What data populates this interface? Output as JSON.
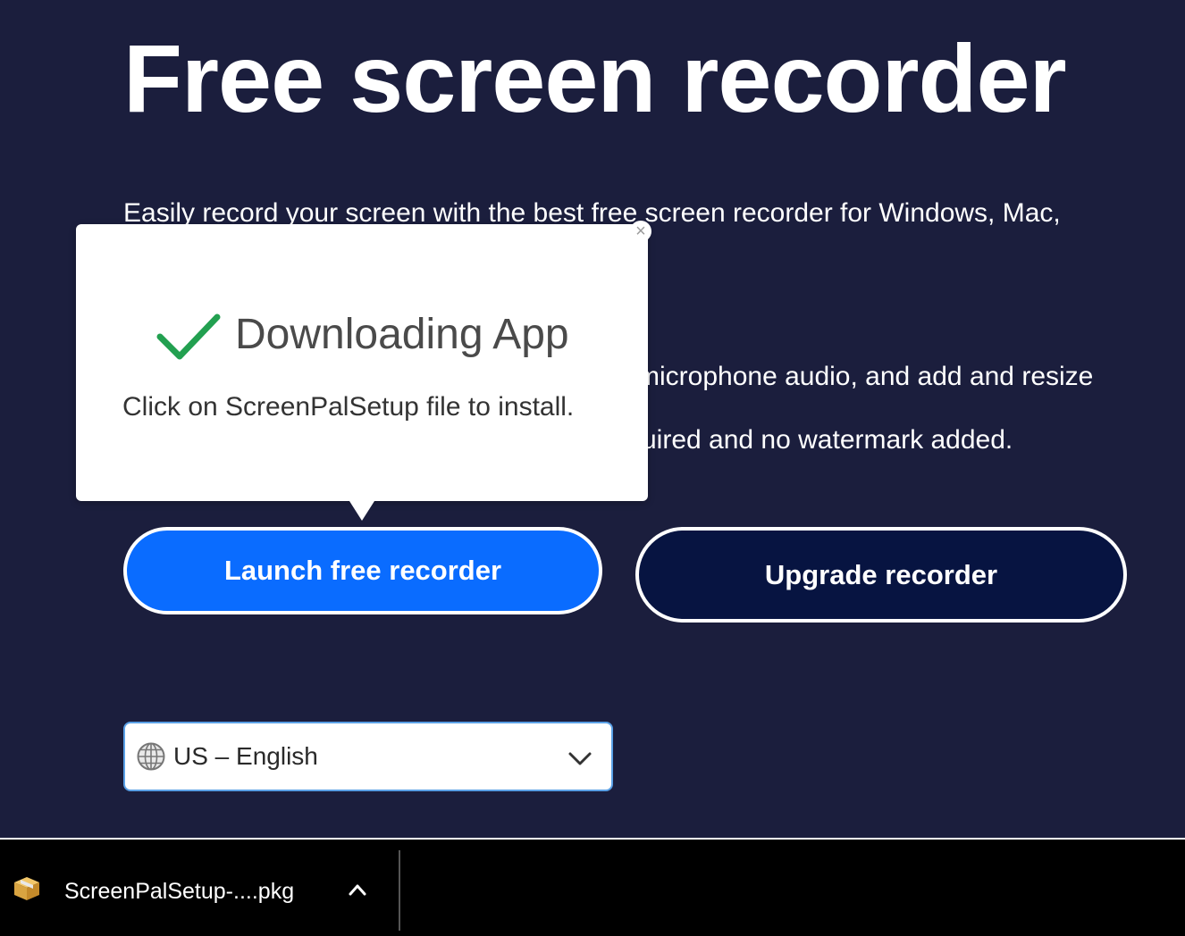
{
  "hero": {
    "title": "Free screen recorder",
    "line1": "Easily record your screen with the best free screen recorder for Windows, Mac,",
    "line2": "microphone audio, and add and resize",
    "line3": "uired and no watermark added."
  },
  "buttons": {
    "launch_label": "Launch free recorder",
    "upgrade_label": "Upgrade recorder"
  },
  "language": {
    "selected": "US – English"
  },
  "popup": {
    "title": "Downloading App",
    "message": "Click on ScreenPalSetup file to install.",
    "close_label": "×"
  },
  "download_bar": {
    "file_name": "ScreenPalSetup-....pkg"
  },
  "colors": {
    "background": "#1b1e3d",
    "launch_button": "#0a6cff",
    "upgrade_button": "#071441",
    "check": "#22a050"
  }
}
